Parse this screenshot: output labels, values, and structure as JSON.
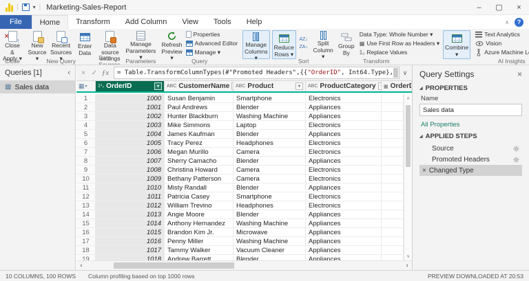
{
  "title_bar": {
    "title": "Marketing-Sales-Report"
  },
  "menu": {
    "tabs": [
      "File",
      "Home",
      "Transform",
      "Add Column",
      "View",
      "Tools",
      "Help"
    ],
    "active": "Home"
  },
  "ribbon": {
    "groups": {
      "close": "Close",
      "new_query": "New Query",
      "data_sources": "Data Sources",
      "parameters": "Parameters",
      "query": "Query",
      "sort": "Sort",
      "transform": "Transform",
      "ai_insights": "AI Insights"
    },
    "close_apply": "Close &\nApply ▾",
    "new_source": "New\nSource ▾",
    "recent_sources": "Recent\nSources ▾",
    "enter_data": "Enter\nData",
    "data_source_settings": "Data source\nsettings",
    "manage_parameters": "Manage\nParameters ▾",
    "refresh_preview": "Refresh\nPreview ▾",
    "properties": "Properties",
    "advanced_editor": "Advanced Editor",
    "manage": "Manage ▾",
    "manage_columns": "Manage\nColumns ▾",
    "reduce_rows": "Reduce\nRows ▾",
    "sort_asc": "AZ↓",
    "sort_desc": "ZA↓",
    "split_column": "Split\nColumn ▾",
    "group_by": "Group\nBy",
    "data_type": "Data Type: Whole Number ▾",
    "use_first_row": "Use First Row as Headers ▾",
    "replace_values": "Replace Values",
    "combine": "Combine\n▾",
    "text_analytics": "Text Analytics",
    "vision": "Vision",
    "aml": "Azure Machine Learning"
  },
  "queries_pane": {
    "header": "Queries [1]",
    "items": [
      {
        "label": "Sales data",
        "selected": true
      }
    ]
  },
  "formula_bar": {
    "prefix": "= Table.TransformColumnTypes(#\"Promoted Headers\",{{",
    "string_literal": "\"OrderID\"",
    "suffix": ", Int64.Type},"
  },
  "grid": {
    "columns": [
      {
        "name": "OrderID",
        "type": "number",
        "selected": true
      },
      {
        "name": "CustomerName",
        "type": "text"
      },
      {
        "name": "Product",
        "type": "text"
      },
      {
        "name": "ProductCategory",
        "type": "text"
      },
      {
        "name": "OrderDat",
        "type": "date"
      }
    ],
    "rows": [
      [
        "1",
        "1000",
        "Susan Benjamin",
        "Smartphone",
        "Electronics",
        ""
      ],
      [
        "2",
        "1001",
        "Paul Andrews",
        "Blender",
        "Appliances",
        ""
      ],
      [
        "3",
        "1002",
        "Hunter Blackburn",
        "Washing Machine",
        "Appliances",
        ""
      ],
      [
        "4",
        "1003",
        "Mike Simmons",
        "Laptop",
        "Electronics",
        ""
      ],
      [
        "5",
        "1004",
        "James Kaufman",
        "Blender",
        "Appliances",
        ""
      ],
      [
        "6",
        "1005",
        "Tracy Perez",
        "Headphones",
        "Electronics",
        ""
      ],
      [
        "7",
        "1006",
        "Megan Murillo",
        "Camera",
        "Electronics",
        ""
      ],
      [
        "8",
        "1007",
        "Sherry Camacho",
        "Blender",
        "Appliances",
        ""
      ],
      [
        "9",
        "1008",
        "Christina Howard",
        "Camera",
        "Electronics",
        ""
      ],
      [
        "10",
        "1009",
        "Bethany Patterson",
        "Camera",
        "Electronics",
        ""
      ],
      [
        "11",
        "1010",
        "Misty Randall",
        "Blender",
        "Appliances",
        ""
      ],
      [
        "12",
        "1011",
        "Patricia Casey",
        "Smartphone",
        "Electronics",
        ""
      ],
      [
        "13",
        "1012",
        "William Trevino",
        "Headphones",
        "Electronics",
        ""
      ],
      [
        "14",
        "1013",
        "Angie Moore",
        "Blender",
        "Appliances",
        ""
      ],
      [
        "15",
        "1014",
        "Anthony Hernandez",
        "Washing Machine",
        "Appliances",
        ""
      ],
      [
        "16",
        "1015",
        "Brandon Kim Jr.",
        "Microwave",
        "Appliances",
        ""
      ],
      [
        "17",
        "1016",
        "Penny Miller",
        "Washing Machine",
        "Appliances",
        ""
      ],
      [
        "18",
        "1017",
        "Tammy Walker",
        "Vacuum Cleaner",
        "Appliances",
        ""
      ],
      [
        "19",
        "1018",
        "Andrew Barrett",
        "Blender",
        "Appliances",
        ""
      ]
    ]
  },
  "query_settings": {
    "title": "Query Settings",
    "properties_header": "PROPERTIES",
    "name_label": "Name",
    "name_value": "Sales data",
    "all_properties": "All Properties",
    "applied_steps_header": "APPLIED STEPS",
    "applied_steps": [
      {
        "label": "Source",
        "gear": true
      },
      {
        "label": "Promoted Headers",
        "gear": true
      },
      {
        "label": "Changed Type",
        "selected": true,
        "deletable": true
      }
    ]
  },
  "status_bar": {
    "left": "10 COLUMNS, 100 ROWS",
    "profiling": "Column profiling based on top 1000 rows",
    "right": "PREVIEW DOWNLOADED AT 20:53"
  },
  "icons": {
    "chevron_down": "▾",
    "chevron_up": "∧",
    "chevron_left": "‹",
    "chevron_right": "›",
    "scroll_up": "∧",
    "scroll_down": "∨",
    "minimize": "–",
    "maximize": "▢",
    "close": "×",
    "cancel": "×",
    "check": "✓",
    "fx": "ƒx",
    "help": "?",
    "type_number": "1²₃",
    "type_text": "ABC",
    "type_date": "▦",
    "table": "▦",
    "replace": "1₂",
    "section_tri": "◢"
  },
  "colors": {
    "file_tab_bg": "#3665b3",
    "accent_teal": "#00b294",
    "selected_header_bg": "#0a6c51",
    "highlight_btn_bg": "#e4effa",
    "highlight_btn_border": "#94bee3",
    "link_green": "#1a7e67",
    "help_badge": "#2f6fd0",
    "string_red": "#a31515"
  }
}
